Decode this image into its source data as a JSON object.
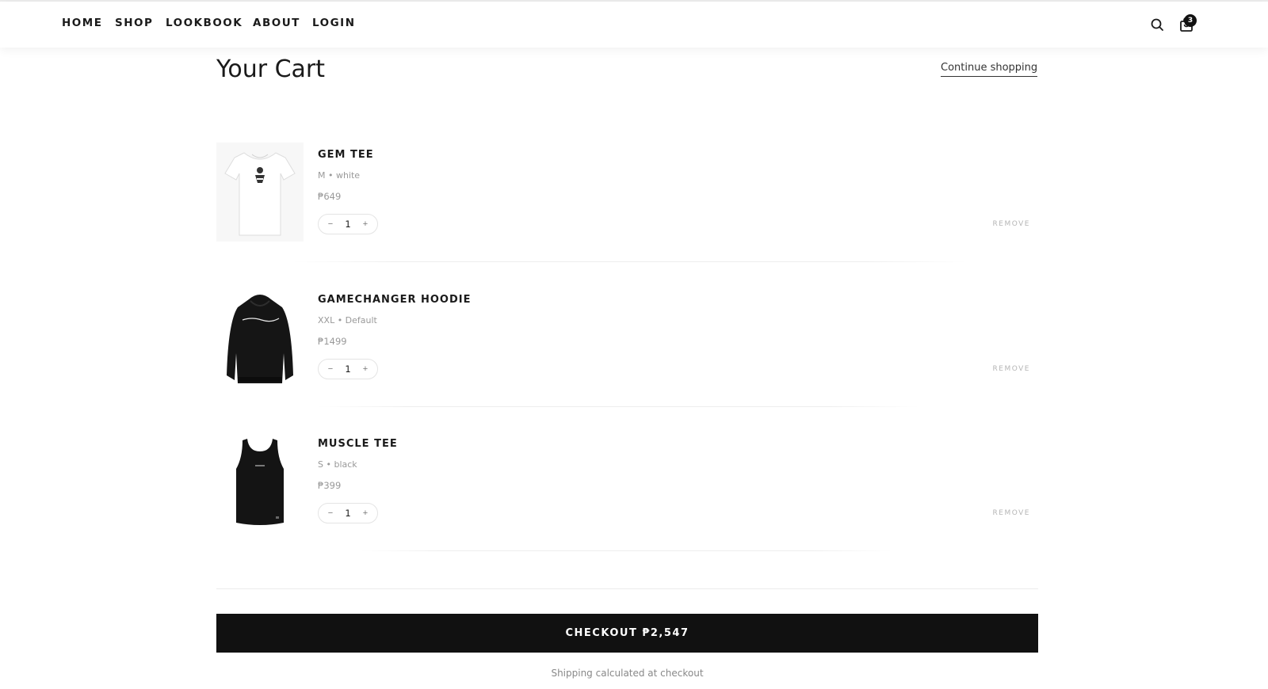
{
  "nav": {
    "links": [
      "HOME",
      "SHOP",
      "LOOKBOOK",
      "ABOUT",
      "LOGIN"
    ],
    "cart_count": "3",
    "icons": [
      "search-icon",
      "shopping-bag-icon"
    ]
  },
  "page": {
    "title": "Your Cart",
    "continue_label": "Continue shopping"
  },
  "items": [
    {
      "name": "GEM TEE",
      "variant": "M • white",
      "price": "₱649",
      "qty": "1",
      "remove_label": "REMOVE",
      "image": "white-tshirt"
    },
    {
      "name": "GAMECHANGER HOODIE",
      "variant": "XXL • Default",
      "price": "₱1499",
      "qty": "1",
      "remove_label": "REMOVE",
      "image": "black-hoodie"
    },
    {
      "name": "MUSCLE TEE",
      "variant": "S • black",
      "price": "₱399",
      "qty": "1",
      "remove_label": "REMOVE",
      "image": "black-tank-top"
    }
  ],
  "qty_controls": {
    "minus": "−",
    "plus": "+"
  },
  "checkout": {
    "label": "CHECKOUT ₱2,547",
    "note": "Shipping calculated at checkout"
  },
  "colors": {
    "primary": "#111111",
    "muted": "#999999",
    "remove": "#b5b5b5"
  }
}
